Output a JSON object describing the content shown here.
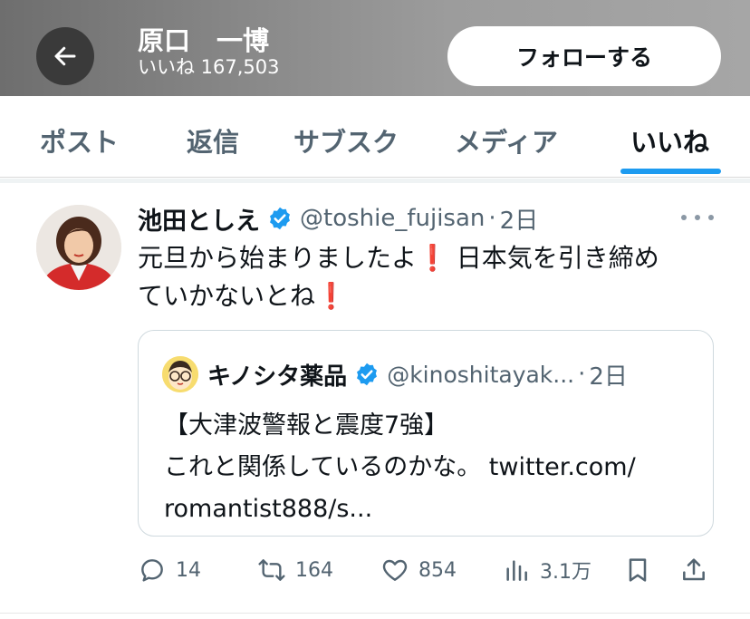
{
  "header": {
    "name": "原口　一博",
    "likes_label": "いいね 167,503",
    "follow_label": "フォローする"
  },
  "tabs": [
    {
      "label": "ポスト"
    },
    {
      "label": "返信"
    },
    {
      "label": "サブスク"
    },
    {
      "label": "メディア"
    },
    {
      "label": "いいね",
      "active": true
    }
  ],
  "tweet": {
    "author_name": "池田としえ",
    "handle": "@toshie_fujisan",
    "separator": "·",
    "time": "2日",
    "text_line1": "元旦から始まりましたよ",
    "text_line1b": "日本気を引き締め",
    "text_line2": "ていかないとね",
    "exclamation": "❗",
    "quote": {
      "author_name": "キノシタ薬品",
      "handle": "@kinoshitayak...",
      "separator": "·",
      "time": "2日",
      "line1": "【大津波警報と震度7強】",
      "line2": "これと関係しているのかな。 twitter.com/",
      "line3": "romantist888/s..."
    },
    "actions": {
      "replies": "14",
      "reposts": "164",
      "likes": "854",
      "views": "3.1万"
    }
  },
  "colors": {
    "accent": "#1d9bf0",
    "verified": "#1d9bf0",
    "muted_text": "#536471",
    "exclamation": "#e0222b"
  },
  "icons": [
    "back-arrow-icon",
    "verified-badge-icon",
    "more-icon",
    "reply-icon",
    "repost-icon",
    "like-icon",
    "views-icon",
    "bookmark-icon",
    "share-icon"
  ]
}
